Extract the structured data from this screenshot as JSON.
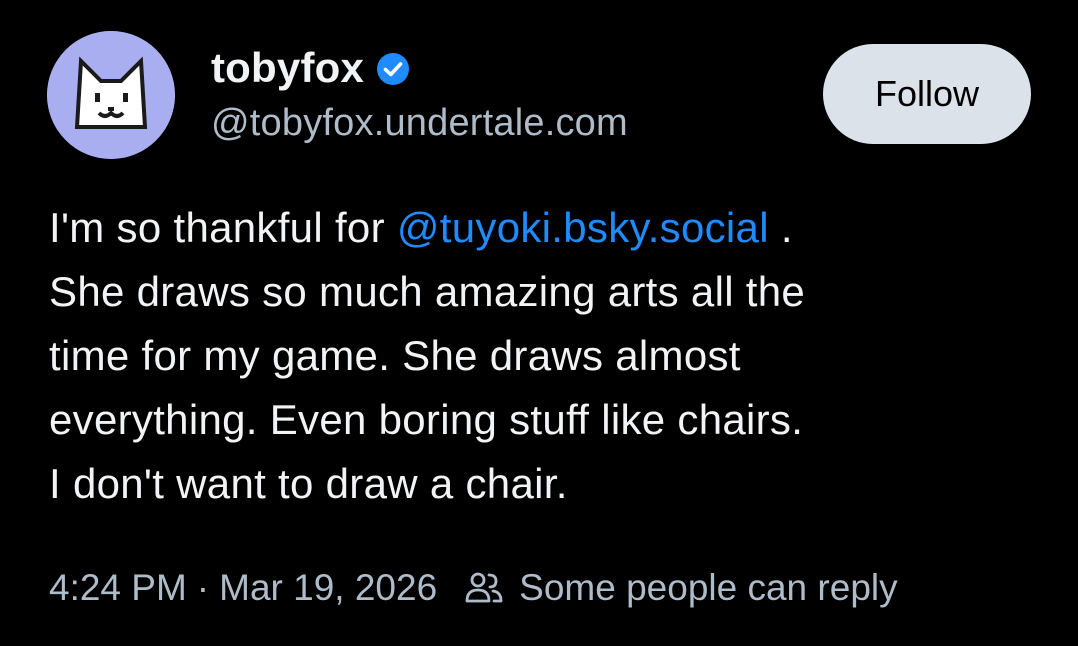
{
  "author": {
    "display_name": "tobyfox",
    "handle": "@tobyfox.undertale.com",
    "avatar_icon": "white-dog-avatar",
    "verified_icon": "verified-check-icon",
    "avatar_color": "#a9aef0",
    "verified_color": "#208bfe"
  },
  "follow_button": {
    "label": "Follow"
  },
  "post": {
    "line1_before": "I'm so thankful for ",
    "mention": "@tuyoki.bsky.social",
    "line1_after": " .",
    "line2": "She draws so much amazing arts all the",
    "line3": "time for my game. She draws almost",
    "line4": "everything. Even boring stuff like chairs.",
    "line5": "I don't want to draw a chair."
  },
  "meta": {
    "time": "4:24 PM",
    "separator": "·",
    "date": "Mar 19, 2026",
    "reply_icon": "people-icon",
    "reply_setting": "Some people can reply"
  },
  "colors": {
    "background": "#000000",
    "text": "#f1f3f5",
    "muted": "#aebbc9",
    "link": "#208bfe",
    "button_bg": "#dce2ea"
  }
}
